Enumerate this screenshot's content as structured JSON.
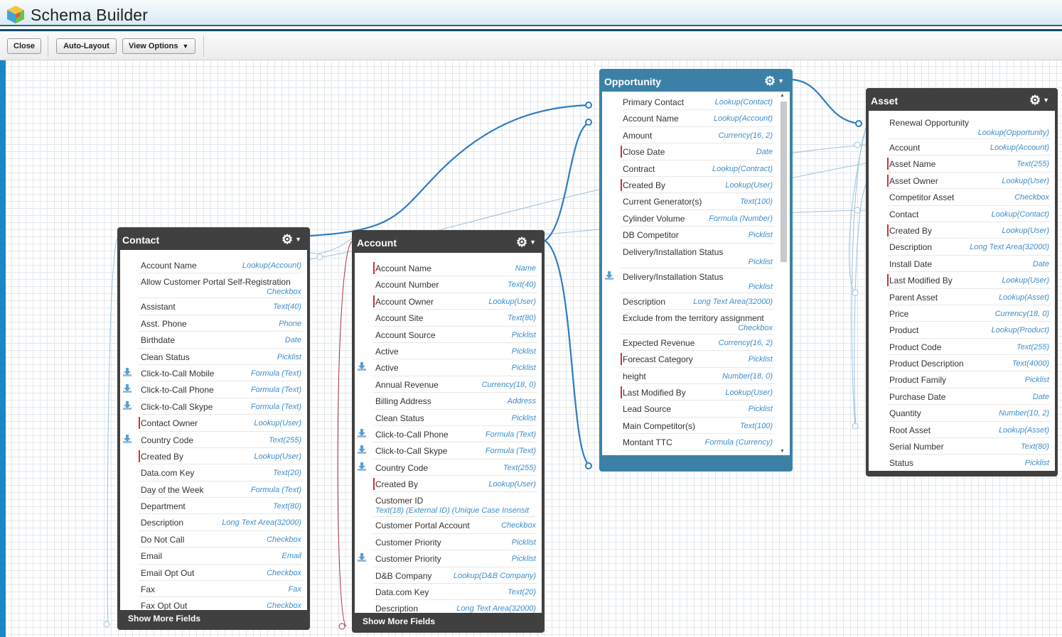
{
  "app": {
    "title": "Schema Builder"
  },
  "toolbar": {
    "close": "Close",
    "auto_layout": "Auto-Layout",
    "view_options": "View Options"
  },
  "colors": {
    "header_line": "#0f4a6b",
    "accent_blue": "#1d84c8",
    "selected_object": "#3b81a7",
    "object_header": "#404040",
    "type_text": "#3e8ecb",
    "required_marker": "#d23131"
  },
  "objects": {
    "contact": {
      "name": "Contact",
      "more": "Show More Fields",
      "fields": [
        {
          "name": "Account Name",
          "type": "Lookup(Account)"
        },
        {
          "name": "Allow Customer Portal Self-Registration",
          "type": "Checkbox",
          "two": true
        },
        {
          "name": "Assistant",
          "type": "Text(40)"
        },
        {
          "name": "Asst. Phone",
          "type": "Phone"
        },
        {
          "name": "Birthdate",
          "type": "Date"
        },
        {
          "name": "Clean Status",
          "type": "Picklist"
        },
        {
          "name": "Click-to-Call Mobile",
          "type": "Formula (Text)",
          "managed": true
        },
        {
          "name": "Click-to-Call Phone",
          "type": "Formula (Text)",
          "managed": true
        },
        {
          "name": "Click-to-Call Skype",
          "type": "Formula (Text)",
          "managed": true
        },
        {
          "name": "Contact Owner",
          "type": "Lookup(User)",
          "required": true
        },
        {
          "name": "Country Code",
          "type": "Text(255)",
          "managed": true
        },
        {
          "name": "Created By",
          "type": "Lookup(User)",
          "required": true
        },
        {
          "name": "Data.com Key",
          "type": "Text(20)"
        },
        {
          "name": "Day of the Week",
          "type": "Formula (Text)"
        },
        {
          "name": "Department",
          "type": "Text(80)"
        },
        {
          "name": "Description",
          "type": "Long Text Area(32000)"
        },
        {
          "name": "Do Not Call",
          "type": "Checkbox"
        },
        {
          "name": "Email",
          "type": "Email"
        },
        {
          "name": "Email Opt Out",
          "type": "Checkbox"
        },
        {
          "name": "Fax",
          "type": "Fax"
        },
        {
          "name": "Fax Opt Out",
          "type": "Checkbox"
        }
      ]
    },
    "account": {
      "name": "Account",
      "more": "Show More Fields",
      "fields": [
        {
          "name": "Account Name",
          "type": "Name",
          "required": true
        },
        {
          "name": "Account Number",
          "type": "Text(40)"
        },
        {
          "name": "Account Owner",
          "type": "Lookup(User)",
          "required": true
        },
        {
          "name": "Account Site",
          "type": "Text(80)"
        },
        {
          "name": "Account Source",
          "type": "Picklist"
        },
        {
          "name": "Active",
          "type": "Picklist"
        },
        {
          "name": "Active",
          "type": "Picklist",
          "managed": true
        },
        {
          "name": "Annual Revenue",
          "type": "Currency(18, 0)"
        },
        {
          "name": "Billing Address",
          "type": "Address"
        },
        {
          "name": "Clean Status",
          "type": "Picklist"
        },
        {
          "name": "Click-to-Call Phone",
          "type": "Formula (Text)",
          "managed": true
        },
        {
          "name": "Click-to-Call Skype",
          "type": "Formula (Text)",
          "managed": true
        },
        {
          "name": "Country Code",
          "type": "Text(255)",
          "managed": true
        },
        {
          "name": "Created By",
          "type": "Lookup(User)",
          "required": true
        },
        {
          "name": "Customer ID",
          "type": "Text(18) (External ID) (Unique Case Insensit",
          "two": true,
          "left": true
        },
        {
          "name": "Customer Portal Account",
          "type": "Checkbox"
        },
        {
          "name": "Customer Priority",
          "type": "Picklist"
        },
        {
          "name": "Customer Priority",
          "type": "Picklist",
          "managed": true
        },
        {
          "name": "D&B Company",
          "type": "Lookup(D&B Company)"
        },
        {
          "name": "Data.com Key",
          "type": "Text(20)"
        },
        {
          "name": "Description",
          "type": "Long Text Area(32000)"
        }
      ]
    },
    "opportunity": {
      "name": "Opportunity",
      "fields": [
        {
          "name": "Primary Contact",
          "type": "Lookup(Contact)"
        },
        {
          "name": "Account Name",
          "type": "Lookup(Account)"
        },
        {
          "name": "Amount",
          "type": "Currency(16, 2)"
        },
        {
          "name": "Close Date",
          "type": "Date",
          "required": true
        },
        {
          "name": "Contract",
          "type": "Lookup(Contract)"
        },
        {
          "name": "Created By",
          "type": "Lookup(User)",
          "required": true
        },
        {
          "name": "Current Generator(s)",
          "type": "Text(100)"
        },
        {
          "name": "Cylinder Volume",
          "type": "Formula (Number)"
        },
        {
          "name": "DB Competitor",
          "type": "Picklist"
        },
        {
          "name": "Delivery/Installation Status",
          "type": "Picklist",
          "two": true
        },
        {
          "name": "Delivery/Installation Status",
          "type": "Picklist",
          "two": true,
          "managed": true
        },
        {
          "name": "Description",
          "type": "Long Text Area(32000)"
        },
        {
          "name": "Exclude from the territory assignment",
          "type": "Checkbox",
          "two": true
        },
        {
          "name": "Expected Revenue",
          "type": "Currency(16, 2)"
        },
        {
          "name": "Forecast Category",
          "type": "Picklist",
          "required": true
        },
        {
          "name": "height",
          "type": "Number(18, 0)"
        },
        {
          "name": "Last Modified By",
          "type": "Lookup(User)",
          "required": true
        },
        {
          "name": "Lead Source",
          "type": "Picklist"
        },
        {
          "name": "Main Competitor(s)",
          "type": "Text(100)"
        },
        {
          "name": "Montant TTC",
          "type": "Formula (Currency)"
        }
      ]
    },
    "asset": {
      "name": "Asset",
      "fields": [
        {
          "name": "Renewal Opportunity",
          "type": "Lookup(Opportunity)",
          "two": true
        },
        {
          "name": "Account",
          "type": "Lookup(Account)"
        },
        {
          "name": "Asset Name",
          "type": "Text(255)",
          "required": true
        },
        {
          "name": "Asset Owner",
          "type": "Lookup(User)",
          "required": true
        },
        {
          "name": "Competitor Asset",
          "type": "Checkbox"
        },
        {
          "name": "Contact",
          "type": "Lookup(Contact)"
        },
        {
          "name": "Created By",
          "type": "Lookup(User)",
          "required": true
        },
        {
          "name": "Description",
          "type": "Long Text Area(32000)"
        },
        {
          "name": "Install Date",
          "type": "Date"
        },
        {
          "name": "Last Modified By",
          "type": "Lookup(User)",
          "required": true
        },
        {
          "name": "Parent Asset",
          "type": "Lookup(Asset)"
        },
        {
          "name": "Price",
          "type": "Currency(18, 0)"
        },
        {
          "name": "Product",
          "type": "Lookup(Product)"
        },
        {
          "name": "Product Code",
          "type": "Text(255)"
        },
        {
          "name": "Product Description",
          "type": "Text(4000)"
        },
        {
          "name": "Product Family",
          "type": "Picklist"
        },
        {
          "name": "Purchase Date",
          "type": "Date"
        },
        {
          "name": "Quantity",
          "type": "Number(10, 2)"
        },
        {
          "name": "Root Asset",
          "type": "Lookup(Asset)"
        },
        {
          "name": "Serial Number",
          "type": "Text(80)"
        },
        {
          "name": "Status",
          "type": "Picklist"
        }
      ]
    }
  }
}
